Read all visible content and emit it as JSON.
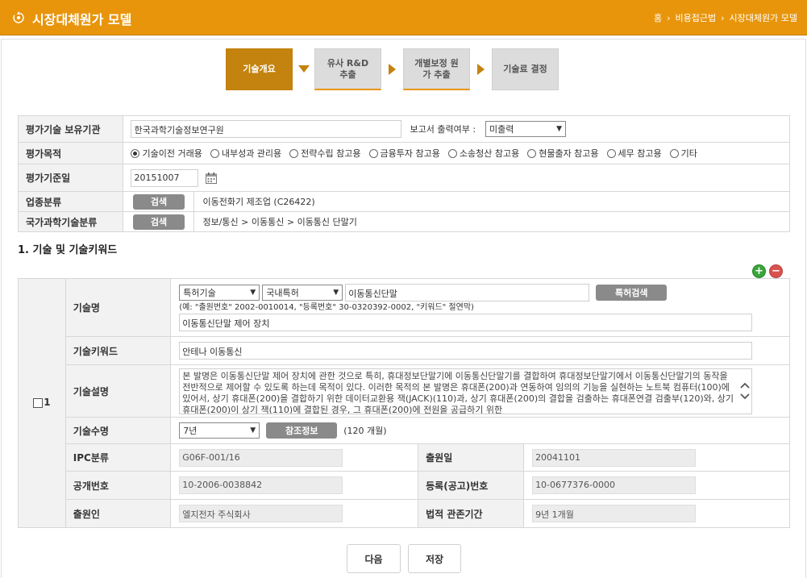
{
  "header": {
    "title": "시장대체원가 모델",
    "breadcrumb": [
      "홈",
      "비용접근법",
      "시장대체원가 모델"
    ],
    "bg_color": "#e8950c"
  },
  "steps": [
    {
      "label": "기술개요",
      "active": true
    },
    {
      "label": "유사 R&D 추출",
      "active": false
    },
    {
      "label": "개별보정 원가 추출",
      "active": false
    },
    {
      "label": "기술료 결정",
      "active": false
    }
  ],
  "info": {
    "owner_label": "평가기술 보유기관",
    "owner_value": "한국과학기술정보연구원",
    "report_label": "보고서 출력여부 :",
    "report_value": "미출력",
    "purpose_label": "평가목적",
    "purpose_options": [
      "기술이전 거래용",
      "내부성과 관리용",
      "전략수립 참고용",
      "금융투자 참고용",
      "소송청산 참고용",
      "현물출자 참고용",
      "세무 참고용",
      "기타"
    ],
    "purpose_selected": 0,
    "base_date_label": "평가기준일",
    "base_date_value": "20151007",
    "industry_label": "업종분류",
    "industry_search": "검색",
    "industry_value": "이동전화기 제조업 (C26422)",
    "national_label": "국가과학기술분류",
    "national_search": "검색",
    "national_value": "정보/통신 > 이동통신 > 이동통신 단말기"
  },
  "section1": {
    "title": "1. 기술 및 기술키워드",
    "row_number": "1",
    "tech_name_label": "기술명",
    "tech_type": "특허기술",
    "patent_scope": "국내특허",
    "patent_query": "이동통신단말",
    "patent_search": "특허검색",
    "hint": "(예: \"출원번호\" 2002-0010014, \"등록번호\" 30-0320392-0002, \"키워드\" 절연막)",
    "tech_name_value": "이동통신단말 제어 장치",
    "keyword_label": "기술키워드",
    "keyword_value": "안테나 이동통신",
    "desc_label": "기술설명",
    "desc_value": "본 발명은 이동통신단말 제어 장치에 관한 것으로 특히, 휴대정보단말기에 이동통신단말기를 결합하여 휴대정보단말기에서 이동통신단말기의 동작을 전반적으로 제어할 수 있도록 하는데 목적이 있다. 이러한 목적의 본 발명은 휴대폰(200)과 연동하여 임의의 기능을 실현하는 노트북 컴퓨터(100)에 있어서, 상기 휴대폰(200)을 결합하기 위한 데이터교환용 잭(JACK)(110)과, 상기 휴대폰(200)의 결합을 검출하는 휴대폰연결 검출부(120)와, 상기 휴대폰(200)이 상기 잭(110)에 결합된 경우, 그 휴대폰(200)에 전원을 공급하기 위한",
    "life_label": "기술수명",
    "life_value": "7년",
    "ref_button": "참조정보",
    "life_months": "(120 개월)",
    "ipc_label": "IPC분류",
    "ipc_value": "G06F-001/16",
    "filing_date_label": "출원일",
    "filing_date_value": "20041101",
    "pub_label": "공개번호",
    "pub_value": "10-2006-0038842",
    "reg_label": "등록(공고)번호",
    "reg_value": "10-0677376-0000",
    "applicant_label": "출원인",
    "applicant_value": "엘지전자 주식회사",
    "term_label": "법적 관존기간",
    "term_value": "9년 1개월"
  },
  "footer": {
    "next": "다음",
    "save": "저장"
  }
}
